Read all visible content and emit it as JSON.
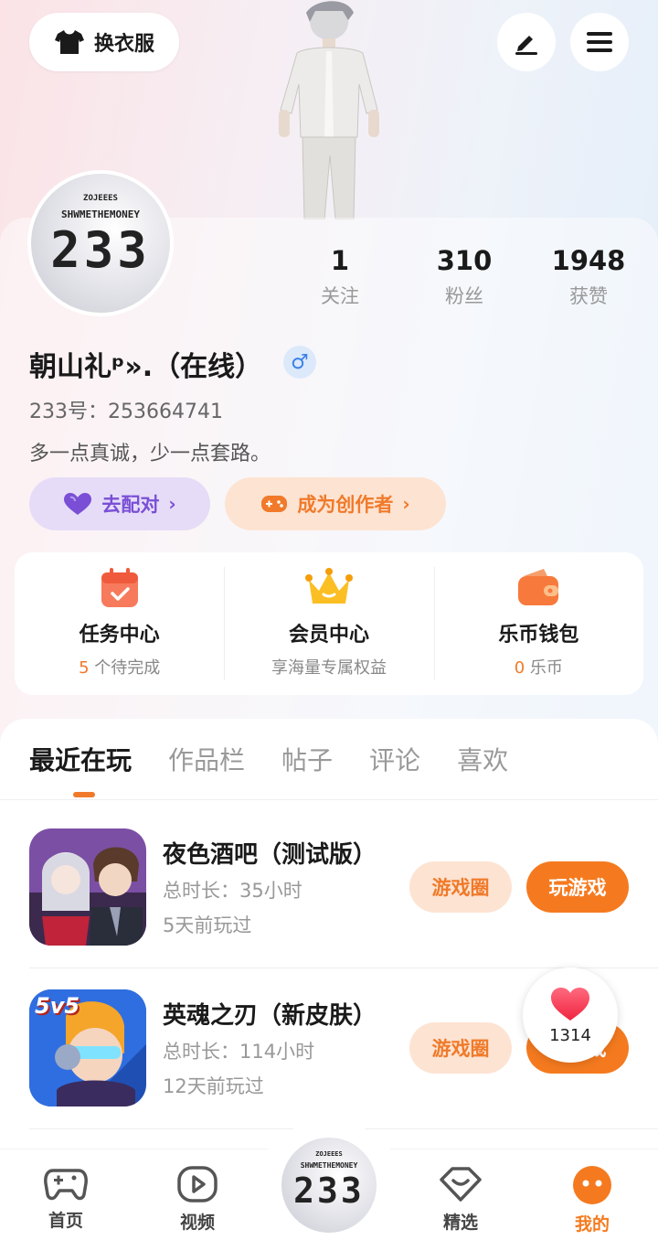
{
  "header": {
    "outfit_label": "换衣服"
  },
  "profile": {
    "avatar_text_top": "ZOJEEES",
    "avatar_text_mid": "SHWMETHEMONEY",
    "avatar_text_big": "233",
    "stats": [
      {
        "num": "1",
        "label": "关注"
      },
      {
        "num": "310",
        "label": "粉丝"
      },
      {
        "num": "1948",
        "label": "获赞"
      }
    ],
    "nickname": "朝山礼ᵖ».（在线）",
    "gender": "♂",
    "user_id": "233号：253664741",
    "bio": "多一点真诚，少一点套路。",
    "match_label": "去配对",
    "creator_label": "成为创作者"
  },
  "services": [
    {
      "title": "任务中心",
      "sub_highlight": "5",
      "sub": " 个待完成"
    },
    {
      "title": "会员中心",
      "sub_highlight": "",
      "sub": "享海量专属权益"
    },
    {
      "title": "乐币钱包",
      "sub_highlight": "0",
      "sub": " 乐币"
    }
  ],
  "tabs": [
    "最近在玩",
    "作品栏",
    "帖子",
    "评论",
    "喜欢"
  ],
  "games": [
    {
      "title": "夜色酒吧（测试版）",
      "duration": "总时长：35小时",
      "last_played": "5天前玩过",
      "circle_label": "游戏圈",
      "play_label": "玩游戏"
    },
    {
      "title": "英魂之刃（新皮肤）",
      "duration": "总时长：114小时",
      "last_played": "12天前玩过",
      "circle_label": "游戏圈",
      "play_label": "玩游戏",
      "icon_text": "5v5"
    }
  ],
  "like": {
    "count": "1314"
  },
  "nav": [
    {
      "label": "首页"
    },
    {
      "label": "视频"
    },
    {
      "label": "精选"
    },
    {
      "label": "我的"
    }
  ]
}
